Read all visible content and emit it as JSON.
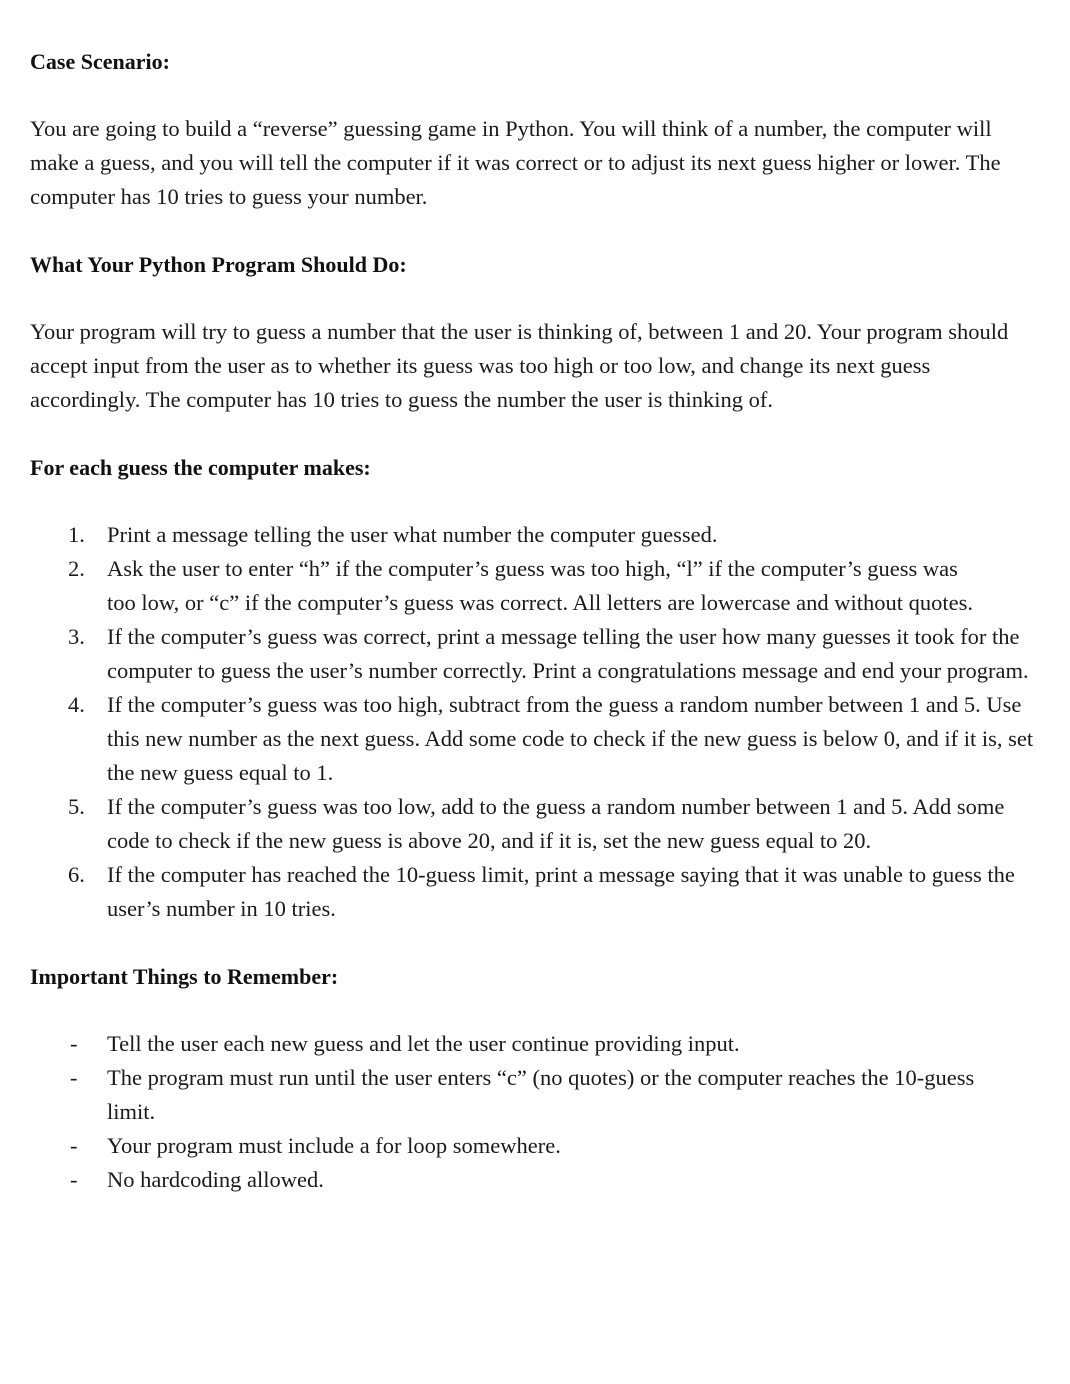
{
  "sections": {
    "case_scenario": {
      "heading": "Case Scenario:",
      "body": "You are going to build a “reverse” guessing game in Python. You will think of a number, the computer will make a guess, and you will tell the computer if it was correct or to adjust its next guess higher or lower. The computer has 10 tries to guess your number."
    },
    "program_should_do": {
      "heading": "What Your Python Program Should Do:",
      "body": "Your program will try to guess a number that the user is thinking of, between 1 and 20. Your program should accept input from the user as to whether its guess was too high or too low, and change its next guess accordingly. The computer has 10 tries to guess the number the user is thinking of."
    },
    "each_guess": {
      "heading": "For each guess the computer makes:",
      "steps": [
        {
          "marker": "1.",
          "text": "Print a message telling the user what number the computer guessed."
        },
        {
          "marker": "2.",
          "text": "Ask the user to enter “h” if the computer’s guess was too high, “l” if the computer’s guess was too low, or “c” if the computer’s guess was correct. All letters are lowercase and without quotes."
        },
        {
          "marker": "3.",
          "text": "If the computer’s guess was correct, print a message telling the user how many guesses it took for the computer to guess the user’s number correctly. Print a congratulations message and end your program."
        },
        {
          "marker": "4.",
          "text": "If the computer’s guess was too high, subtract from the guess a random number between 1 and 5. Use this new number as the next guess. Add some code to check if the new guess is below 0, and if it is, set the new guess equal to 1."
        },
        {
          "marker": "5.",
          "text": "If the computer’s guess was too low, add to the guess a random number between 1 and 5. Add some code to check if the new guess is above 20, and if it is, set the new guess equal to 20."
        },
        {
          "marker": "6.",
          "text": "If the computer has reached the 10-guess limit, print a message saying that it was unable to guess the user’s number in 10 tries."
        }
      ]
    },
    "remember": {
      "heading": "Important Things to Remember:",
      "items": [
        {
          "marker": "-",
          "text": "Tell the user each new guess and let the user continue providing input."
        },
        {
          "marker": "-",
          "text": "The program must run until the user enters “c” (no quotes) or the computer reaches the 10-guess limit."
        },
        {
          "marker": "-",
          "text": "Your program must include a for loop somewhere."
        },
        {
          "marker": "-",
          "text": "No hardcoding allowed."
        }
      ]
    }
  }
}
